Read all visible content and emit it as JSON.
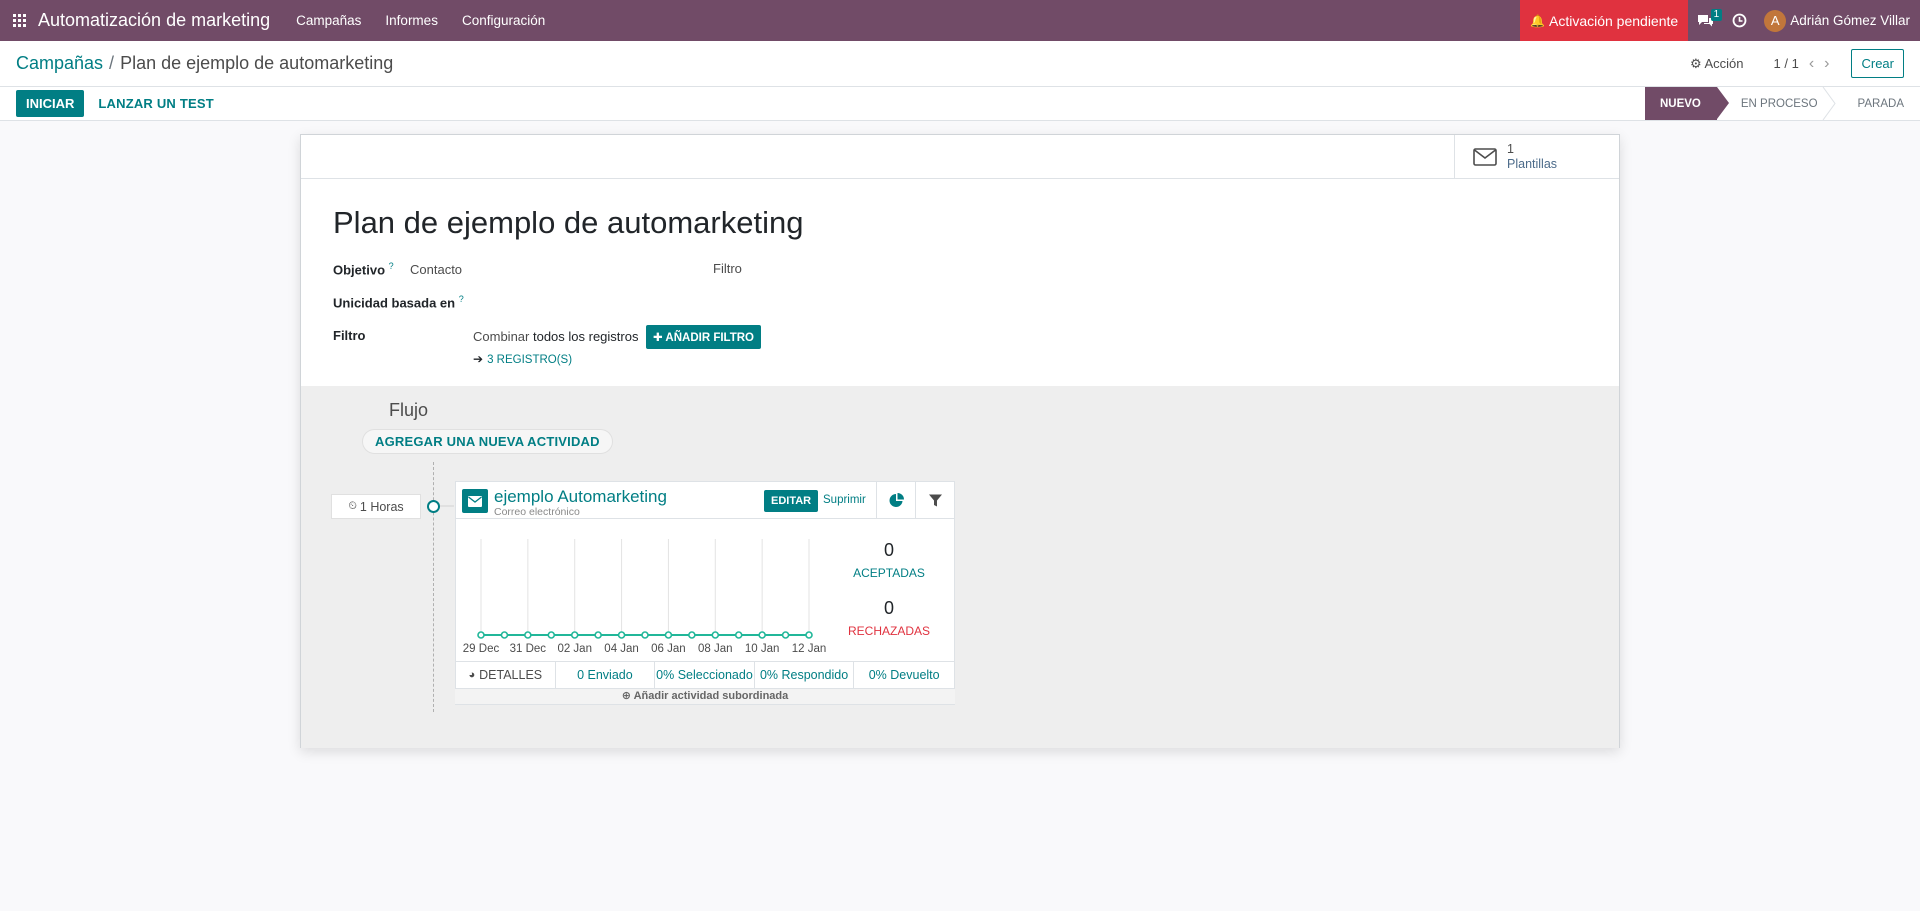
{
  "navbar": {
    "app_title": "Automatización de marketing",
    "menu": [
      "Campañas",
      "Informes",
      "Configuración"
    ],
    "activation": "Activación pendiente",
    "chat_count": "1",
    "user_initial": "A",
    "user_name": "Adrián Gómez Villar"
  },
  "breadcrumb": {
    "parent": "Campañas",
    "separator": "/",
    "current": "Plan de ejemplo de automarketing"
  },
  "control": {
    "action": "Acción",
    "pager": "1 / 1",
    "create": "Crear"
  },
  "statusbar": {
    "start": "INICIAR",
    "test": "LANZAR UN TEST",
    "stages": [
      "NUEVO",
      "EN PROCESO",
      "PARADA"
    ],
    "active_stage": "NUEVO"
  },
  "smart_button": {
    "count": "1",
    "label": "Plantillas"
  },
  "form": {
    "title": "Plan de ejemplo de automarketing",
    "objective_label": "Objetivo",
    "objective_value": "Contacto",
    "filter_label_right": "Filtro",
    "unique_label": "Unicidad basada en",
    "filter_label": "Filtro",
    "combine_prefix": "Combinar",
    "combine_value": "todos los registros",
    "add_filter": "AÑADIR FILTRO",
    "records": "3 REGISTRO(S)",
    "help_mark": "?"
  },
  "flow": {
    "title": "Flujo",
    "add_activity": "AGREGAR UNA NUEVA ACTIVIDAD",
    "time": "1 Horas",
    "activity": {
      "name": "ejemplo Automarketing",
      "type": "Correo electrónico",
      "edit": "EDITAR",
      "delete": "Suprimir",
      "accepted_count": "0",
      "accepted_label": "ACEPTADAS",
      "rejected_count": "0",
      "rejected_label": "RECHAZADAS",
      "details": "DETALLES",
      "sent": "0 Enviado",
      "selected": "0% Seleccionado",
      "replied": "0% Respondido",
      "bounced": "0% Devuelto",
      "add_child": "Añadir actividad subordinada"
    }
  },
  "colors": {
    "brand": "#714b67",
    "primary": "#017e84",
    "danger": "#e0323f",
    "chart_line": "#21b799"
  },
  "chart_data": {
    "type": "line",
    "x": [
      "29 Dec",
      "30 Dec",
      "31 Dec",
      "01 Jan",
      "02 Jan",
      "03 Jan",
      "04 Jan",
      "05 Jan",
      "06 Jan",
      "07 Jan",
      "08 Jan",
      "09 Jan",
      "10 Jan",
      "11 Jan",
      "12 Jan"
    ],
    "tick_labels": [
      "29 Dec",
      "31 Dec",
      "02 Jan",
      "04 Jan",
      "06 Jan",
      "08 Jan",
      "10 Jan",
      "12 Jan"
    ],
    "series": [
      {
        "values": [
          0,
          0,
          0,
          0,
          0,
          0,
          0,
          0,
          0,
          0,
          0,
          0,
          0,
          0,
          0
        ]
      }
    ],
    "grid": "vertical"
  }
}
